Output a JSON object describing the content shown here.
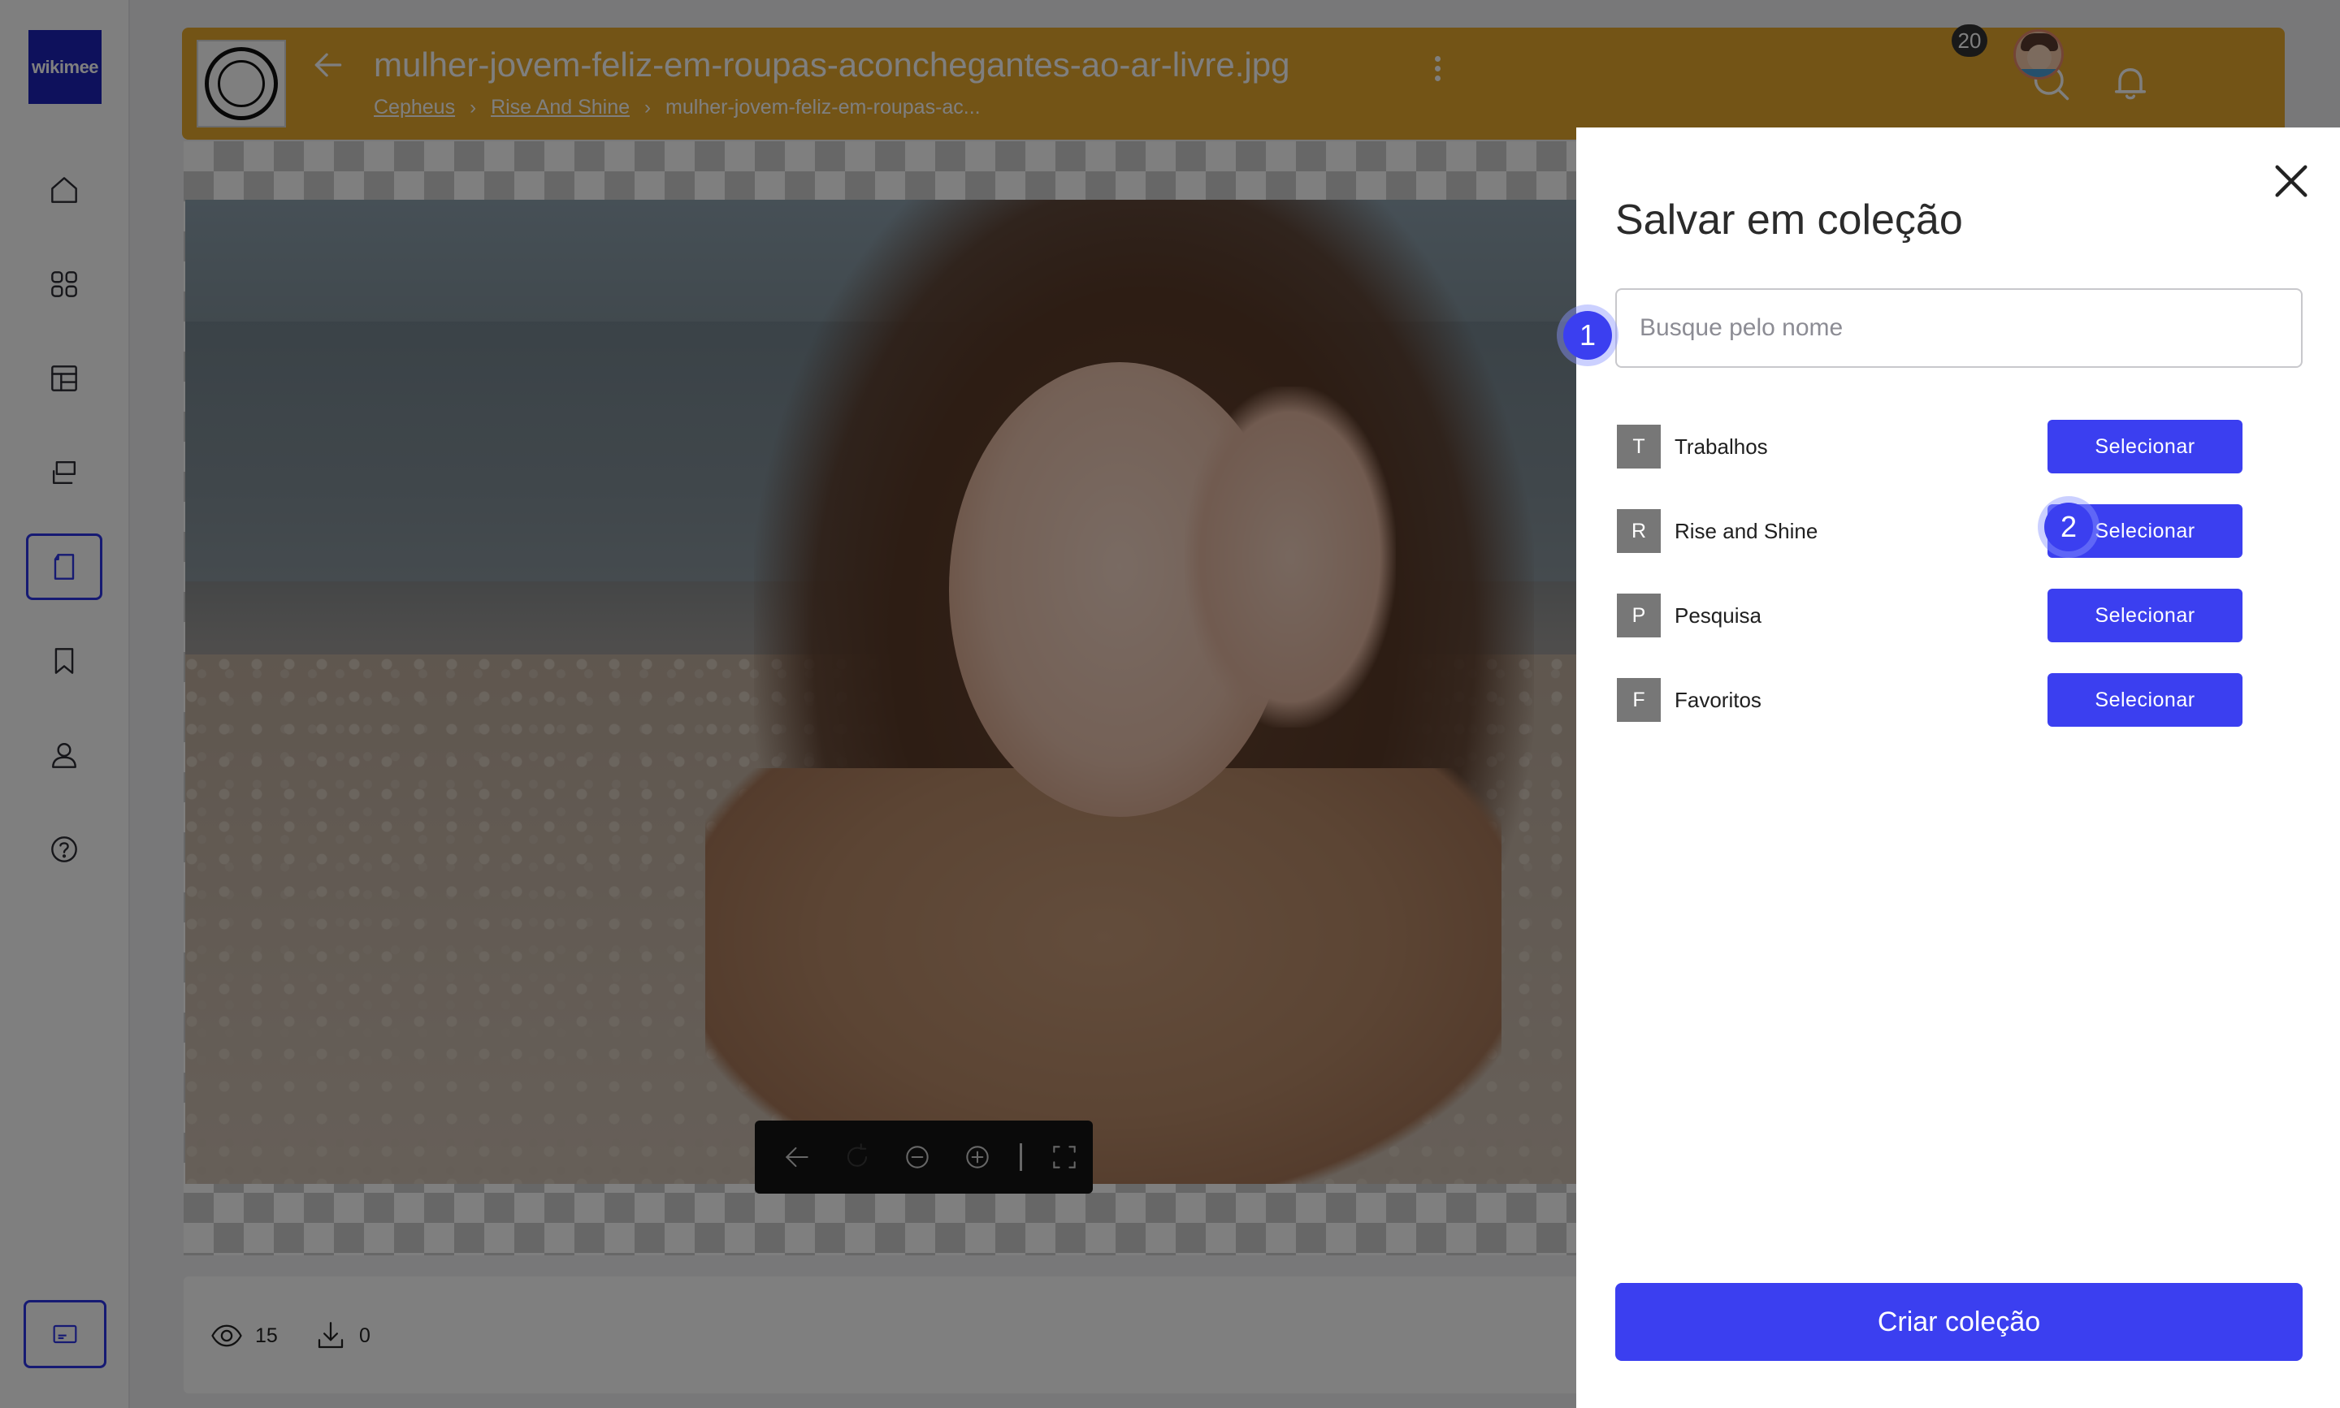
{
  "app": {
    "logo_text": "wikimee"
  },
  "sidebar": {
    "items": [
      {
        "icon": "home-icon"
      },
      {
        "icon": "apps-grid-icon"
      },
      {
        "icon": "layout-icon"
      },
      {
        "icon": "stack-icon"
      },
      {
        "icon": "document-icon",
        "active": true
      },
      {
        "icon": "bookmark-icon"
      },
      {
        "icon": "user-icon"
      },
      {
        "icon": "help-icon"
      }
    ],
    "bottom_icon": "card-icon"
  },
  "header": {
    "title": "mulher-jovem-feliz-em-roupas-aconchegantes-ao-ar-livre.jpg",
    "breadcrumb": [
      "Cepheus",
      "Rise And Shine",
      "mulher-jovem-feliz-em-roupas-ac..."
    ],
    "notification_count": "20",
    "accent_color": "#e6a92c"
  },
  "viewer": {
    "toolbar_icons": [
      "arrow-left-icon",
      "rotate-icon",
      "zoom-out-icon",
      "zoom-in-icon",
      "fullscreen-icon"
    ]
  },
  "stats": {
    "views": "15",
    "downloads": "0"
  },
  "modal": {
    "title": "Salvar em coleção",
    "search_placeholder": "Busque pelo nome",
    "search_value": "",
    "collections": [
      {
        "letter": "T",
        "name": "Trabalhos",
        "button": "Selecionar"
      },
      {
        "letter": "R",
        "name": "Rise and Shine",
        "button": "Selecionar"
      },
      {
        "letter": "P",
        "name": "Pesquisa",
        "button": "Selecionar"
      },
      {
        "letter": "F",
        "name": "Favoritos",
        "button": "Selecionar"
      }
    ],
    "create_button": "Criar coleção",
    "step_markers": [
      "1",
      "2"
    ],
    "button_color": "#3b3ff0"
  }
}
